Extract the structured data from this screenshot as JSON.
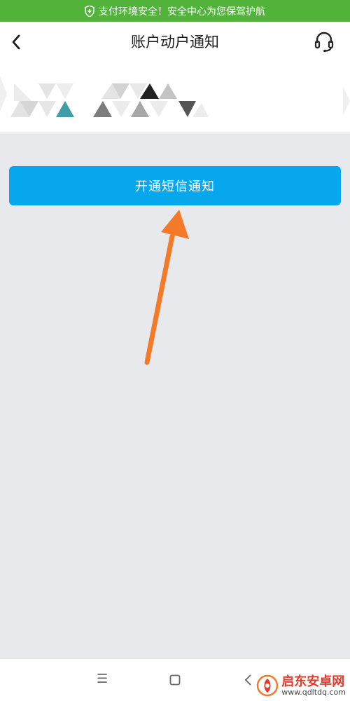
{
  "security_bar": {
    "text": "支付环境安全！安全中心为您保驾护航",
    "color": "#52b33b"
  },
  "header": {
    "title": "账户动户通知",
    "back_icon": "chevron-left-icon",
    "service_icon": "headset-icon"
  },
  "primary_button": {
    "label": "开通短信通知",
    "color": "#07a7ee"
  },
  "annotation": {
    "type": "arrow",
    "color": "#f47a2a"
  },
  "nav": {
    "icons": [
      "menu-icon",
      "home-square-icon",
      "back-icon"
    ]
  },
  "watermark": {
    "title": "启东安卓网",
    "url": "www.qdltdq.com"
  }
}
